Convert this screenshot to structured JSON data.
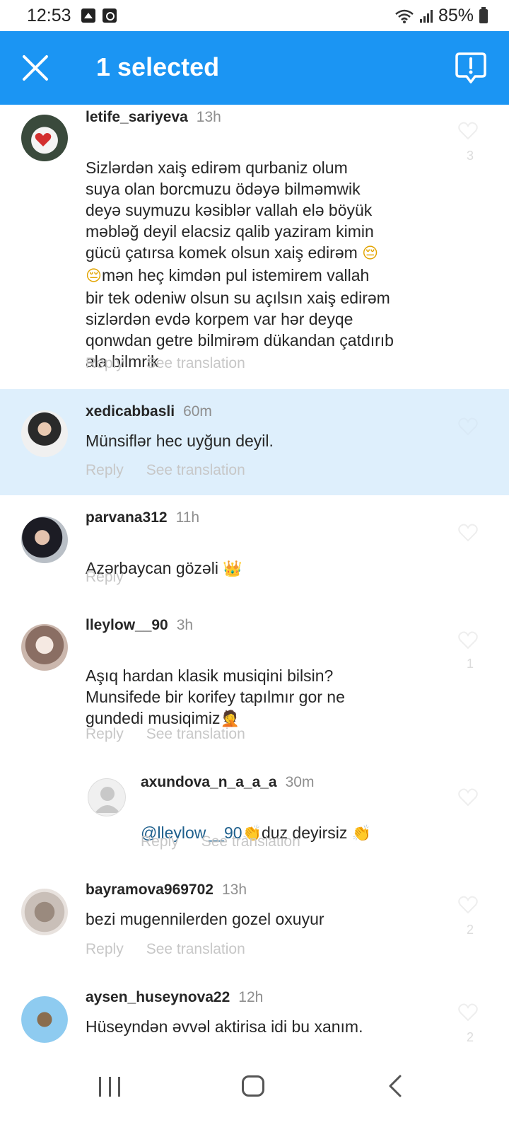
{
  "status_bar": {
    "time": "12:53",
    "battery": "85%"
  },
  "app_bar": {
    "title": "1 selected"
  },
  "comments": [
    {
      "username": "letife_sariyeva",
      "time": "13h",
      "text": "Sizlərdən xaiş edirəm qurbaniz olum\nsuya  olan borcmuzu ödəyə bilməmwik\ndeyə suymuzu  kəsiblər  vallah elə böyük\nməbləğ deyil elacsiz qalib yaziram kimin\ngücü çatırsa komek olsun xaiş edirəm ",
      "text_tail": "mən heç kimdən pul istemirem vallah\nbir tek odeniw olsun su açılsın xaiş edirəm\nsizlərdən evdə korpem var hər deyqe\nqonwdan getre bilmirəm dükandan çatdırıb\nala bilmrik",
      "emoji_1": "😔",
      "emoji_2": "😔",
      "reply": "Reply",
      "see_translation": "See translation",
      "likes": "3"
    },
    {
      "username": "xedicabbasli",
      "time": "60m",
      "text": "Münsiflər hec uyğun deyil.",
      "reply": "Reply",
      "see_translation": "See translation"
    },
    {
      "username": "parvana312",
      "time": "11h",
      "text": "Azərbaycan gözəli ",
      "emoji": "👑",
      "reply": "Reply"
    },
    {
      "username": "lleylow__90",
      "time": "3h",
      "text": "Aşıq hardan klasik musiqini bilsin?\nMunsifede bir korifey tapılmır gor ne\ngundedi musiqimiz",
      "emoji": "🤦",
      "reply": "Reply",
      "see_translation": "See translation",
      "likes": "1"
    },
    {
      "username": "axundova_n_a_a_a",
      "time": "30m",
      "mention": "@lleylow__90",
      "emoji": "👏",
      "text": "duz deyirsiz ",
      "reply": "Reply",
      "see_translation": "See translation"
    },
    {
      "username": "bayramova969702",
      "time": "13h",
      "text": "bezi mugennilerden gozel oxuyur",
      "reply": "Reply",
      "see_translation": "See translation",
      "likes": "2"
    },
    {
      "username": "aysen_huseynova22",
      "time": "12h",
      "text": "Hüseyndən əvvəl aktirisa idi bu xanım.",
      "likes": "2"
    }
  ]
}
